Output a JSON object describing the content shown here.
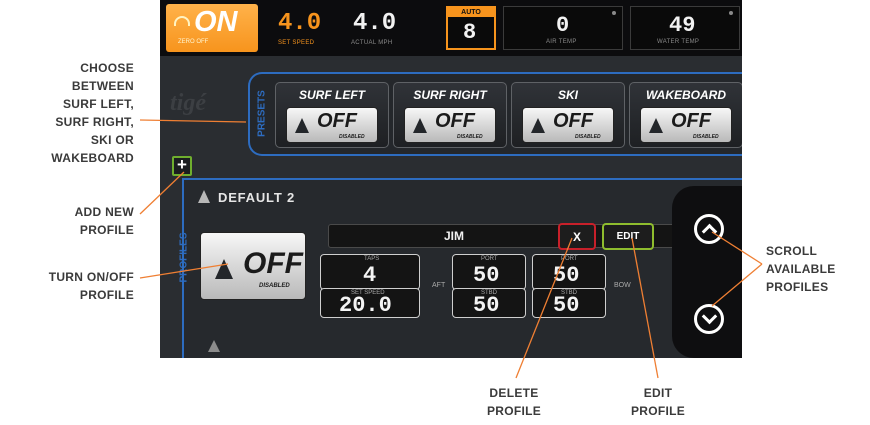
{
  "status": {
    "power": "ON",
    "power_sub": "ZERO OFF",
    "set_speed": "4.0",
    "set_speed_label": "SET SPEED",
    "actual_speed": "4.0",
    "actual_speed_label": "ACTUAL MPH",
    "auto_label": "AUTO",
    "auto_value": "8",
    "air_temp": "0",
    "air_temp_label": "AIR TEMP",
    "water_temp": "49",
    "water_temp_label": "WATER TEMP"
  },
  "brand": "tigé",
  "presets": {
    "section_label": "PRESETS",
    "items": [
      {
        "title": "SURF LEFT",
        "state": "OFF",
        "sub": "DISABLED"
      },
      {
        "title": "SURF RIGHT",
        "state": "OFF",
        "sub": "DISABLED"
      },
      {
        "title": "SKI",
        "state": "OFF",
        "sub": "DISABLED"
      },
      {
        "title": "WAKEBOARD",
        "state": "OFF",
        "sub": "DISABLED"
      }
    ]
  },
  "add_button": "+",
  "profiles": {
    "section_label": "PROFILES",
    "current_name": "DEFAULT 2",
    "toggle_state": "OFF",
    "toggle_sub": "DISABLED",
    "profile_name": "JIM",
    "delete_label": "X",
    "edit_label": "EDIT",
    "taps_label": "TAPS",
    "taps_value": "4",
    "set_speed_label": "SET SPEED",
    "set_speed_value": "20.0",
    "aft_label": "AFT",
    "bow_label": "BOW",
    "aft_port_label": "PORT",
    "aft_port_value": "50",
    "aft_stbd_label": "STBD",
    "aft_stbd_value": "50",
    "bow_port_label": "PORT",
    "bow_port_value": "50",
    "bow_stbd_label": "STBD",
    "bow_stbd_value": "50"
  },
  "annotations": {
    "choose": [
      "CHOOSE",
      "BETWEEN",
      "SURF LEFT,",
      "SURF RIGHT,",
      "SKI OR",
      "WAKEBOARD"
    ],
    "add_new": [
      "ADD NEW",
      "PROFILE"
    ],
    "turn": [
      "TURN ON/OFF",
      "PROFILE"
    ],
    "scroll": [
      "SCROLL",
      "AVAILABLE",
      "PROFILES"
    ],
    "delete": [
      "DELETE",
      "PROFILE"
    ],
    "edit": [
      "EDIT",
      "PROFILE"
    ]
  },
  "colors": {
    "accent_orange": "#f7941d",
    "accent_blue": "#2d6cc0",
    "annotation_line": "#ef7f33",
    "delete_red": "#c8202a",
    "edit_green": "#8fbd2e"
  },
  "icons": [
    "gauge-icon",
    "tige-logo-icon",
    "plus-icon",
    "scroll-up-icon",
    "scroll-down-icon",
    "close-icon"
  ]
}
